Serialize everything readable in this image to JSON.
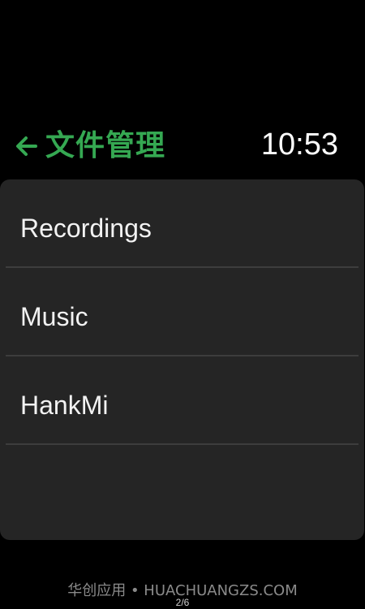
{
  "header": {
    "title": "文件管理",
    "back_icon": "arrow-left-icon",
    "clock": "10:53"
  },
  "list": {
    "items": [
      {
        "label": "Recordings"
      },
      {
        "label": "Music"
      },
      {
        "label": "HankMi"
      }
    ]
  },
  "footer": {
    "watermark": "华创应用 • HUACHUANGZS.COM",
    "page_indicator": "2/6"
  },
  "colors": {
    "accent": "#35a852",
    "background": "#000000",
    "card": "#252525",
    "divider": "#3d3d3d"
  }
}
